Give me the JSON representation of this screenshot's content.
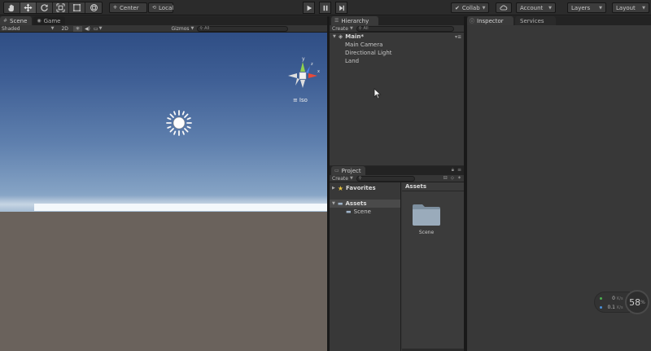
{
  "toolbar": {
    "pivot_label": "Center",
    "space_label": "Local",
    "collab_label": "Collab",
    "account_label": "Account",
    "layers_label": "Layers",
    "layout_label": "Layout"
  },
  "scene": {
    "tabs": [
      {
        "label": "Scene",
        "icon": "scene-icon"
      },
      {
        "label": "Game",
        "icon": "game-icon"
      }
    ],
    "shading_label": "Shaded",
    "mode_2d_label": "2D",
    "gizmos_label": "Gizmos",
    "search_placeholder": "All",
    "projection_label": "Iso",
    "gizmo_axes": {
      "y": "y",
      "x": "x",
      "z": "z"
    },
    "colors": {
      "sky_top": "#2f4e85",
      "sky_horizon": "#d8e4ec",
      "ground": "#6a625c"
    }
  },
  "hierarchy": {
    "tab_label": "Hierarchy",
    "create_label": "Create",
    "search_placeholder": "All",
    "scene_name": "Main*",
    "items": [
      {
        "label": "Main Camera"
      },
      {
        "label": "Directional Light"
      },
      {
        "label": "Land"
      }
    ]
  },
  "project": {
    "tab_label": "Project",
    "create_label": "Create",
    "favorites_label": "Favorites",
    "assets_label": "Assets",
    "assets_children": [
      {
        "label": "Scene"
      }
    ],
    "breadcrumb": "Assets",
    "tiles": [
      {
        "label": "Scene",
        "icon": "folder-icon"
      }
    ]
  },
  "inspector": {
    "tabs": [
      {
        "label": "Inspector",
        "icon": "info-icon"
      },
      {
        "label": "Services"
      }
    ]
  },
  "network": {
    "upload_value": "0",
    "upload_unit": "K/s",
    "download_value": "0.1",
    "download_unit": "K/s",
    "percent_value": "58",
    "percent_unit": "%",
    "colors": {
      "upload": "#4caf50",
      "download": "#4a90d9"
    }
  }
}
